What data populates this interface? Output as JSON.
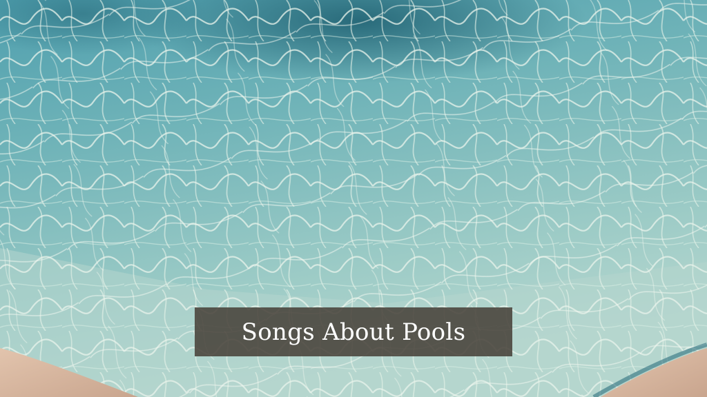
{
  "caption": {
    "title": "Songs About Pools"
  },
  "colors": {
    "water_light": "#a9d6d3",
    "water_mid": "#6fb3b8",
    "water_deep": "#2f7d8e",
    "shadow": "#1f5f70",
    "caustic": "#e8f3ea",
    "stone_edge": "#d7b9a2",
    "caption_background": "#48423a",
    "caption_text": "#ffffff"
  }
}
